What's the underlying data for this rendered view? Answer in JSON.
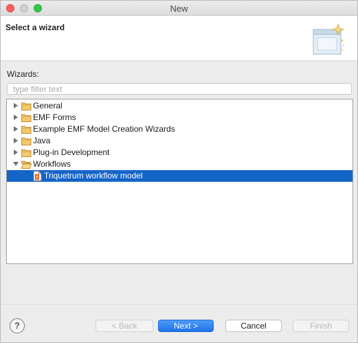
{
  "window": {
    "title": "New"
  },
  "header": {
    "title": "Select a wizard",
    "icon": "wizard-banner-icon"
  },
  "wizards": {
    "label": "Wizards:",
    "filter": {
      "value": "",
      "placeholder": "type filter text"
    },
    "tree": [
      {
        "label": "General",
        "expanded": false,
        "icon": "folder-icon"
      },
      {
        "label": "EMF Forms",
        "expanded": false,
        "icon": "folder-icon"
      },
      {
        "label": "Example EMF Model Creation Wizards",
        "expanded": false,
        "icon": "folder-icon"
      },
      {
        "label": "Java",
        "expanded": false,
        "icon": "folder-icon"
      },
      {
        "label": "Plug-in Development",
        "expanded": false,
        "icon": "folder-icon"
      },
      {
        "label": "Workflows",
        "expanded": true,
        "icon": "folder-open-icon",
        "children": [
          {
            "label": "Triquetrum workflow model",
            "selected": true,
            "icon": "workflow-file-icon"
          }
        ]
      }
    ]
  },
  "buttons": {
    "help": "?",
    "back": {
      "label": "< Back",
      "enabled": false
    },
    "next": {
      "label": "Next >",
      "enabled": true,
      "default": true
    },
    "cancel": {
      "label": "Cancel",
      "enabled": true
    },
    "finish": {
      "label": "Finish",
      "enabled": false
    }
  },
  "colors": {
    "selection": "#1565c9",
    "primary_button": "#1f73e8"
  }
}
